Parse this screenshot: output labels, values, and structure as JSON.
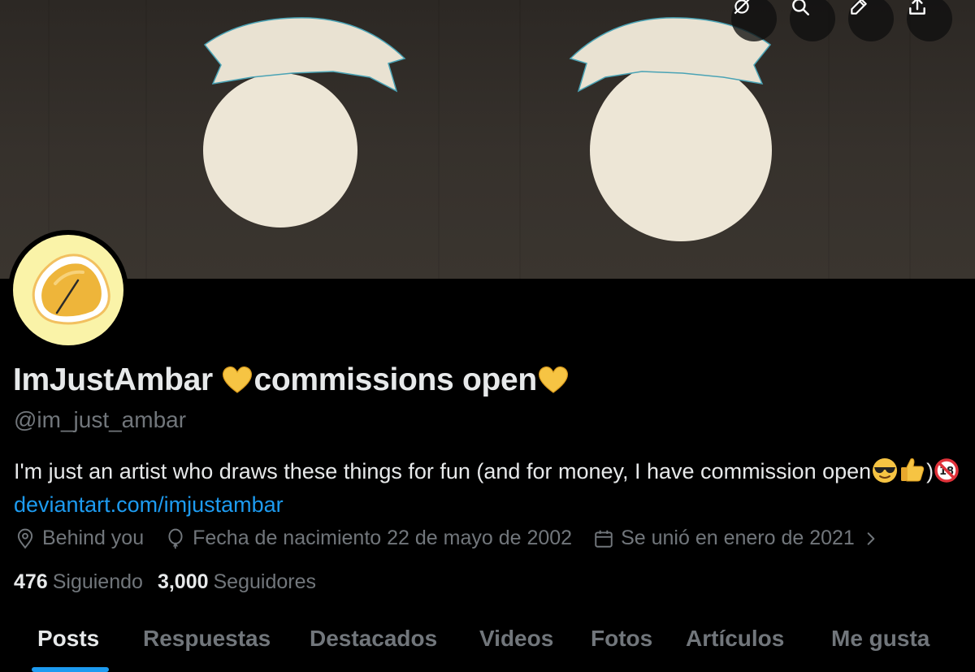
{
  "profile": {
    "name": "ImJustAmbar",
    "name_suffix": "commissions open",
    "handle": "@im_just_ambar",
    "bio_text": "I'm just an artist who draws these things for fun (and for money, I have commission open",
    "bio_paren": ")",
    "bio_link": "deviantart.com/imjustambar",
    "location": "Behind you",
    "birthday": "Fecha de nacimiento 22 de mayo de 2002",
    "joined": "Se unió en enero de 2021",
    "following_count": "476",
    "following_label": "Siguiendo",
    "followers_count": "3,000",
    "followers_label": "Seguidores"
  },
  "header_buttons": [
    {
      "icon": "grok-icon"
    },
    {
      "icon": "search-icon"
    },
    {
      "icon": "edit-icon"
    },
    {
      "icon": "share-icon"
    }
  ],
  "tabs": [
    "Posts",
    "Respuestas",
    "Destacados",
    "Videos",
    "Fotos",
    "Artículos",
    "Me gusta"
  ],
  "active_tab": "Posts",
  "colors": {
    "background": "#000000",
    "text": "#e7e9ea",
    "muted": "#71767b",
    "link": "#1d9bf0",
    "avatar_bg": "#faf3a8"
  }
}
